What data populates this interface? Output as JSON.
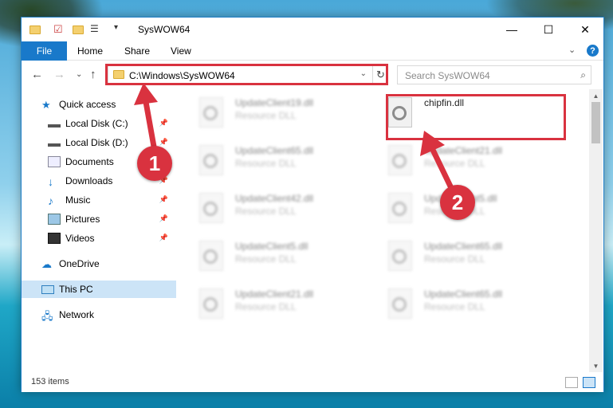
{
  "window": {
    "title": "SysWOW64",
    "controls": {
      "minimize": "—",
      "maximize": "☐",
      "close": "✕"
    }
  },
  "ribbon": {
    "tabs": [
      "File",
      "Home",
      "Share",
      "View"
    ],
    "expand": "⌄",
    "help": "?"
  },
  "address": {
    "path": "C:\\Windows\\SysWOW64",
    "dropdown": "⌄",
    "refresh": "↻"
  },
  "search": {
    "placeholder": "Search SysWOW64"
  },
  "sidebar": {
    "items": [
      {
        "label": "Quick access",
        "icon": "star-icon"
      },
      {
        "label": "Local Disk (C:)",
        "icon": "drive-icon"
      },
      {
        "label": "Local Disk (D:)",
        "icon": "drive-icon"
      },
      {
        "label": "Documents",
        "icon": "documents-icon"
      },
      {
        "label": "Downloads",
        "icon": "download-icon"
      },
      {
        "label": "Music",
        "icon": "music-icon"
      },
      {
        "label": "Pictures",
        "icon": "pictures-icon"
      },
      {
        "label": "Videos",
        "icon": "videos-icon"
      },
      {
        "label": "OneDrive",
        "icon": "cloud-icon"
      },
      {
        "label": "This PC",
        "icon": "computer-icon"
      },
      {
        "label": "Network",
        "icon": "network-icon"
      }
    ]
  },
  "files": {
    "left": [
      {
        "name": "UpdateClient19.dll",
        "type": "Resource DLL"
      },
      {
        "name": "UpdateClient65.dll",
        "type": "Resource DLL"
      },
      {
        "name": "UpdateClient42.dll",
        "type": "Resource DLL"
      },
      {
        "name": "UpdateClient5.dll",
        "type": "Resource DLL"
      },
      {
        "name": "UpdateClient21.dll",
        "type": "Resource DLL"
      }
    ],
    "right": [
      {
        "name": "chipfin.dll",
        "type": ""
      },
      {
        "name": "UpdateClient21.dll",
        "type": "Resource DLL"
      },
      {
        "name": "UpdateClient5.dll",
        "type": "Resource DLL"
      },
      {
        "name": "UpdateClient65.dll",
        "type": "Resource DLL"
      },
      {
        "name": "UpdateClient65.dll",
        "type": "Resource DLL"
      }
    ]
  },
  "status": {
    "count": "153 items"
  },
  "annotations": {
    "step1": "1",
    "step2": "2",
    "color": "#d9323f"
  }
}
